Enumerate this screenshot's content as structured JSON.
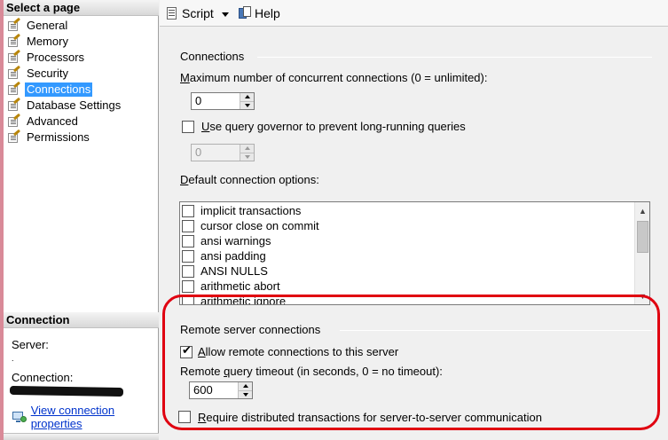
{
  "left_pane": {
    "select_page_header": "Select a page",
    "pages": [
      {
        "label": "General"
      },
      {
        "label": "Memory"
      },
      {
        "label": "Processors"
      },
      {
        "label": "Security"
      },
      {
        "label": "Connections",
        "selected": true
      },
      {
        "label": "Database Settings"
      },
      {
        "label": "Advanced"
      },
      {
        "label": "Permissions"
      }
    ],
    "connection_header": "Connection",
    "server_label": "Server:",
    "server_value": ".",
    "connection_label": "Connection:",
    "view_connection_link": "View connection properties"
  },
  "toolbar": {
    "script_label": "Script",
    "help_label": "Help"
  },
  "connections": {
    "group_title": "Connections",
    "max_conn_prefix": "",
    "max_conn_ul": "M",
    "max_conn_rest": "aximum number of concurrent connections (0 = unlimited):",
    "max_conn_value": "0",
    "query_gov_ul": "U",
    "query_gov_rest": "se query governor to prevent long-running queries",
    "query_gov_checked": false,
    "query_gov_value": "0",
    "default_opts_ul": "D",
    "default_opts_rest": "efault connection options:",
    "options": [
      {
        "label": "implicit transactions",
        "checked": false
      },
      {
        "label": "cursor close on commit",
        "checked": false
      },
      {
        "label": "ansi warnings",
        "checked": false
      },
      {
        "label": "ansi padding",
        "checked": false
      },
      {
        "label": "ANSI NULLS",
        "checked": false
      },
      {
        "label": "arithmetic abort",
        "checked": false
      },
      {
        "label": "arithmetic ignore",
        "checked": false
      }
    ]
  },
  "remote": {
    "group_title": "Remote server connections",
    "allow_ul": "A",
    "allow_rest": "llow remote connections to this server",
    "allow_checked": true,
    "timeout_pre": "Remote ",
    "timeout_ul": "q",
    "timeout_rest": "uery timeout (in seconds, 0 = no timeout):",
    "timeout_value": "600",
    "require_ul": "R",
    "require_rest": "equire distributed transactions for server-to-server communication",
    "require_checked": false
  },
  "colors": {
    "selection": "#3399ff",
    "highlight_outline": "#e00010",
    "link": "#0033cc"
  }
}
